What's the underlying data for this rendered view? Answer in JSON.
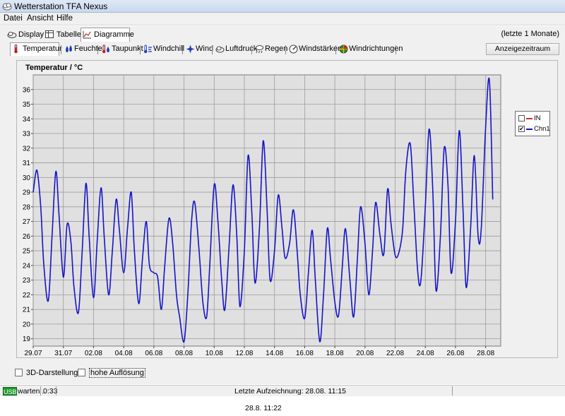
{
  "window": {
    "title": "Wetterstation TFA Nexus"
  },
  "menu": [
    "Datei",
    "Ansicht",
    "Hilfe"
  ],
  "top_tabs": [
    {
      "label": "Display",
      "icon": "display-icon"
    },
    {
      "label": "Tabelle",
      "icon": "table-icon"
    },
    {
      "label": "Diagramme",
      "icon": "chart-icon",
      "active": true
    }
  ],
  "period_label": "(letzte 1 Monate)",
  "sub_tabs": [
    {
      "label": "Temperatur",
      "icon": "thermometer-icon",
      "active": true
    },
    {
      "label": "Feuchte",
      "icon": "humidity-icon"
    },
    {
      "label": "Taupunkt",
      "icon": "dewpoint-icon"
    },
    {
      "label": "Windchill",
      "icon": "windchill-icon"
    },
    {
      "label": "Wind",
      "icon": "wind-icon"
    },
    {
      "label": "Luftdruck",
      "icon": "pressure-icon"
    },
    {
      "label": "Regen",
      "icon": "rain-icon"
    },
    {
      "label": "Windstärken",
      "icon": "windstrength-icon"
    },
    {
      "label": "Windrichtungen",
      "icon": "winddirection-icon"
    }
  ],
  "range_button": "Anzeigezeitraum",
  "options": [
    {
      "label": "3D-Darstellung",
      "checked": false
    },
    {
      "label": "hohe Auflösung",
      "checked": false
    }
  ],
  "status": {
    "usb": "USB",
    "state": "warten ..",
    "elapsed": "0:33",
    "last_record": "Letzte Aufzeichnung: 28.08. 11:15"
  },
  "footer_time": "28.8. 11:22",
  "colors": {
    "series_in": "#d03020",
    "series_chn1": "#1414c8",
    "plot_bg": "#e0e0e0",
    "grid": "#9c9c9c"
  },
  "chart_data": {
    "type": "line",
    "title": "Temperatur / °C",
    "ylim": [
      18.5,
      37
    ],
    "yticks": [
      19,
      20,
      21,
      22,
      23,
      24,
      25,
      26,
      27,
      28,
      29,
      30,
      31,
      32,
      33,
      34,
      35,
      36
    ],
    "xlim": [
      "2023-07-29T00:00",
      "2023-08-28T23:59"
    ],
    "xticks": [
      "29.07",
      "31.07",
      "02.08",
      "04.08",
      "06.08",
      "08.08",
      "10.08",
      "12.08",
      "14.08",
      "16.08",
      "18.08",
      "20.08",
      "22.08",
      "24.08",
      "26.08",
      "28.08"
    ],
    "grid": true,
    "legend_position": "top-right",
    "series": [
      {
        "name": "IN",
        "checked": false,
        "visible": false,
        "points": []
      },
      {
        "name": "Chn1",
        "checked": true,
        "visible": true,
        "points": [
          [
            "2023-07-29T00:00",
            29.0
          ],
          [
            "2023-07-29T06:00",
            30.5
          ],
          [
            "2023-07-29T12:00",
            28.0
          ],
          [
            "2023-07-29T17:00",
            24.0
          ],
          [
            "2023-07-30T00:00",
            21.6
          ],
          [
            "2023-07-30T06:00",
            26.0
          ],
          [
            "2023-07-30T12:00",
            30.4
          ],
          [
            "2023-07-30T17:00",
            27.5
          ],
          [
            "2023-07-31T00:00",
            23.2
          ],
          [
            "2023-07-31T06:00",
            26.8
          ],
          [
            "2023-07-31T12:00",
            25.6
          ],
          [
            "2023-07-31T17:00",
            22.5
          ],
          [
            "2023-08-01T00:00",
            20.8
          ],
          [
            "2023-08-01T06:00",
            25.0
          ],
          [
            "2023-08-01T12:00",
            29.6
          ],
          [
            "2023-08-01T17:00",
            26.0
          ],
          [
            "2023-08-02T00:00",
            21.8
          ],
          [
            "2023-08-02T06:00",
            25.8
          ],
          [
            "2023-08-02T12:00",
            29.3
          ],
          [
            "2023-08-02T17:00",
            26.0
          ],
          [
            "2023-08-03T00:00",
            22.0
          ],
          [
            "2023-08-03T06:00",
            25.0
          ],
          [
            "2023-08-03T12:00",
            28.5
          ],
          [
            "2023-08-03T17:00",
            26.5
          ],
          [
            "2023-08-04T00:00",
            23.5
          ],
          [
            "2023-08-04T06:00",
            26.5
          ],
          [
            "2023-08-04T12:00",
            29.0
          ],
          [
            "2023-08-04T17:00",
            25.0
          ],
          [
            "2023-08-05T00:00",
            21.4
          ],
          [
            "2023-08-05T06:00",
            24.5
          ],
          [
            "2023-08-05T12:00",
            27.0
          ],
          [
            "2023-08-05T17:00",
            24.0
          ],
          [
            "2023-08-06T00:00",
            23.5
          ],
          [
            "2023-08-06T06:00",
            23.2
          ],
          [
            "2023-08-06T12:00",
            21.0
          ],
          [
            "2023-08-06T17:00",
            23.8
          ],
          [
            "2023-08-07T00:00",
            27.2
          ],
          [
            "2023-08-07T06:00",
            25.5
          ],
          [
            "2023-08-07T12:00",
            22.0
          ],
          [
            "2023-08-07T17:00",
            20.5
          ],
          [
            "2023-08-08T00:00",
            18.8
          ],
          [
            "2023-08-08T06:00",
            22.0
          ],
          [
            "2023-08-08T12:00",
            27.0
          ],
          [
            "2023-08-08T17:00",
            28.3
          ],
          [
            "2023-08-09T00:00",
            25.0
          ],
          [
            "2023-08-09T06:00",
            21.5
          ],
          [
            "2023-08-09T12:00",
            20.5
          ],
          [
            "2023-08-09T17:00",
            24.0
          ],
          [
            "2023-08-10T00:00",
            29.5
          ],
          [
            "2023-08-10T06:00",
            27.0
          ],
          [
            "2023-08-10T12:00",
            23.0
          ],
          [
            "2023-08-10T17:00",
            21.0
          ],
          [
            "2023-08-11T00:00",
            25.5
          ],
          [
            "2023-08-11T06:00",
            29.5
          ],
          [
            "2023-08-11T12:00",
            26.0
          ],
          [
            "2023-08-11T17:00",
            21.2
          ],
          [
            "2023-08-12T00:00",
            25.0
          ],
          [
            "2023-08-12T06:00",
            31.5
          ],
          [
            "2023-08-12T12:00",
            27.5
          ],
          [
            "2023-08-12T17:00",
            22.8
          ],
          [
            "2023-08-13T00:00",
            26.5
          ],
          [
            "2023-08-13T06:00",
            32.5
          ],
          [
            "2023-08-13T12:00",
            28.0
          ],
          [
            "2023-08-13T17:00",
            23.0
          ],
          [
            "2023-08-14T00:00",
            25.0
          ],
          [
            "2023-08-14T06:00",
            28.8
          ],
          [
            "2023-08-14T12:00",
            26.5
          ],
          [
            "2023-08-14T17:00",
            24.5
          ],
          [
            "2023-08-15T00:00",
            25.5
          ],
          [
            "2023-08-15T06:00",
            27.8
          ],
          [
            "2023-08-15T12:00",
            25.0
          ],
          [
            "2023-08-15T17:00",
            22.0
          ],
          [
            "2023-08-16T00:00",
            20.4
          ],
          [
            "2023-08-16T06:00",
            23.5
          ],
          [
            "2023-08-16T12:00",
            26.4
          ],
          [
            "2023-08-16T17:00",
            23.0
          ],
          [
            "2023-08-17T00:00",
            18.8
          ],
          [
            "2023-08-17T06:00",
            22.0
          ],
          [
            "2023-08-17T12:00",
            26.5
          ],
          [
            "2023-08-17T17:00",
            24.5
          ],
          [
            "2023-08-18T00:00",
            21.5
          ],
          [
            "2023-08-18T06:00",
            20.6
          ],
          [
            "2023-08-18T12:00",
            24.0
          ],
          [
            "2023-08-18T17:00",
            26.5
          ],
          [
            "2023-08-19T00:00",
            23.0
          ],
          [
            "2023-08-19T06:00",
            20.5
          ],
          [
            "2023-08-19T12:00",
            24.5
          ],
          [
            "2023-08-19T17:00",
            28.0
          ],
          [
            "2023-08-20T00:00",
            25.5
          ],
          [
            "2023-08-20T06:00",
            22.0
          ],
          [
            "2023-08-20T12:00",
            25.0
          ],
          [
            "2023-08-20T17:00",
            28.3
          ],
          [
            "2023-08-21T00:00",
            26.0
          ],
          [
            "2023-08-21T06:00",
            24.8
          ],
          [
            "2023-08-21T12:00",
            29.2
          ],
          [
            "2023-08-21T17:00",
            27.0
          ],
          [
            "2023-08-22T00:00",
            24.7
          ],
          [
            "2023-08-22T06:00",
            24.9
          ],
          [
            "2023-08-22T12:00",
            26.5
          ],
          [
            "2023-08-22T17:00",
            30.5
          ],
          [
            "2023-08-23T00:00",
            32.3
          ],
          [
            "2023-08-23T06:00",
            28.0
          ],
          [
            "2023-08-23T12:00",
            23.5
          ],
          [
            "2023-08-23T17:00",
            23.0
          ],
          [
            "2023-08-24T00:00",
            28.0
          ],
          [
            "2023-08-24T06:00",
            33.3
          ],
          [
            "2023-08-24T12:00",
            29.0
          ],
          [
            "2023-08-24T17:00",
            22.3
          ],
          [
            "2023-08-25T00:00",
            26.0
          ],
          [
            "2023-08-25T06:00",
            32.0
          ],
          [
            "2023-08-25T12:00",
            29.5
          ],
          [
            "2023-08-25T17:00",
            23.5
          ],
          [
            "2023-08-26T00:00",
            27.0
          ],
          [
            "2023-08-26T06:00",
            33.2
          ],
          [
            "2023-08-26T12:00",
            27.8
          ],
          [
            "2023-08-26T17:00",
            22.5
          ],
          [
            "2023-08-27T00:00",
            26.5
          ],
          [
            "2023-08-27T06:00",
            31.5
          ],
          [
            "2023-08-27T12:00",
            26.0
          ],
          [
            "2023-08-27T17:00",
            26.5
          ],
          [
            "2023-08-28T00:00",
            33.5
          ],
          [
            "2023-08-28T06:00",
            36.6
          ],
          [
            "2023-08-28T11:15",
            28.5
          ]
        ]
      }
    ]
  }
}
